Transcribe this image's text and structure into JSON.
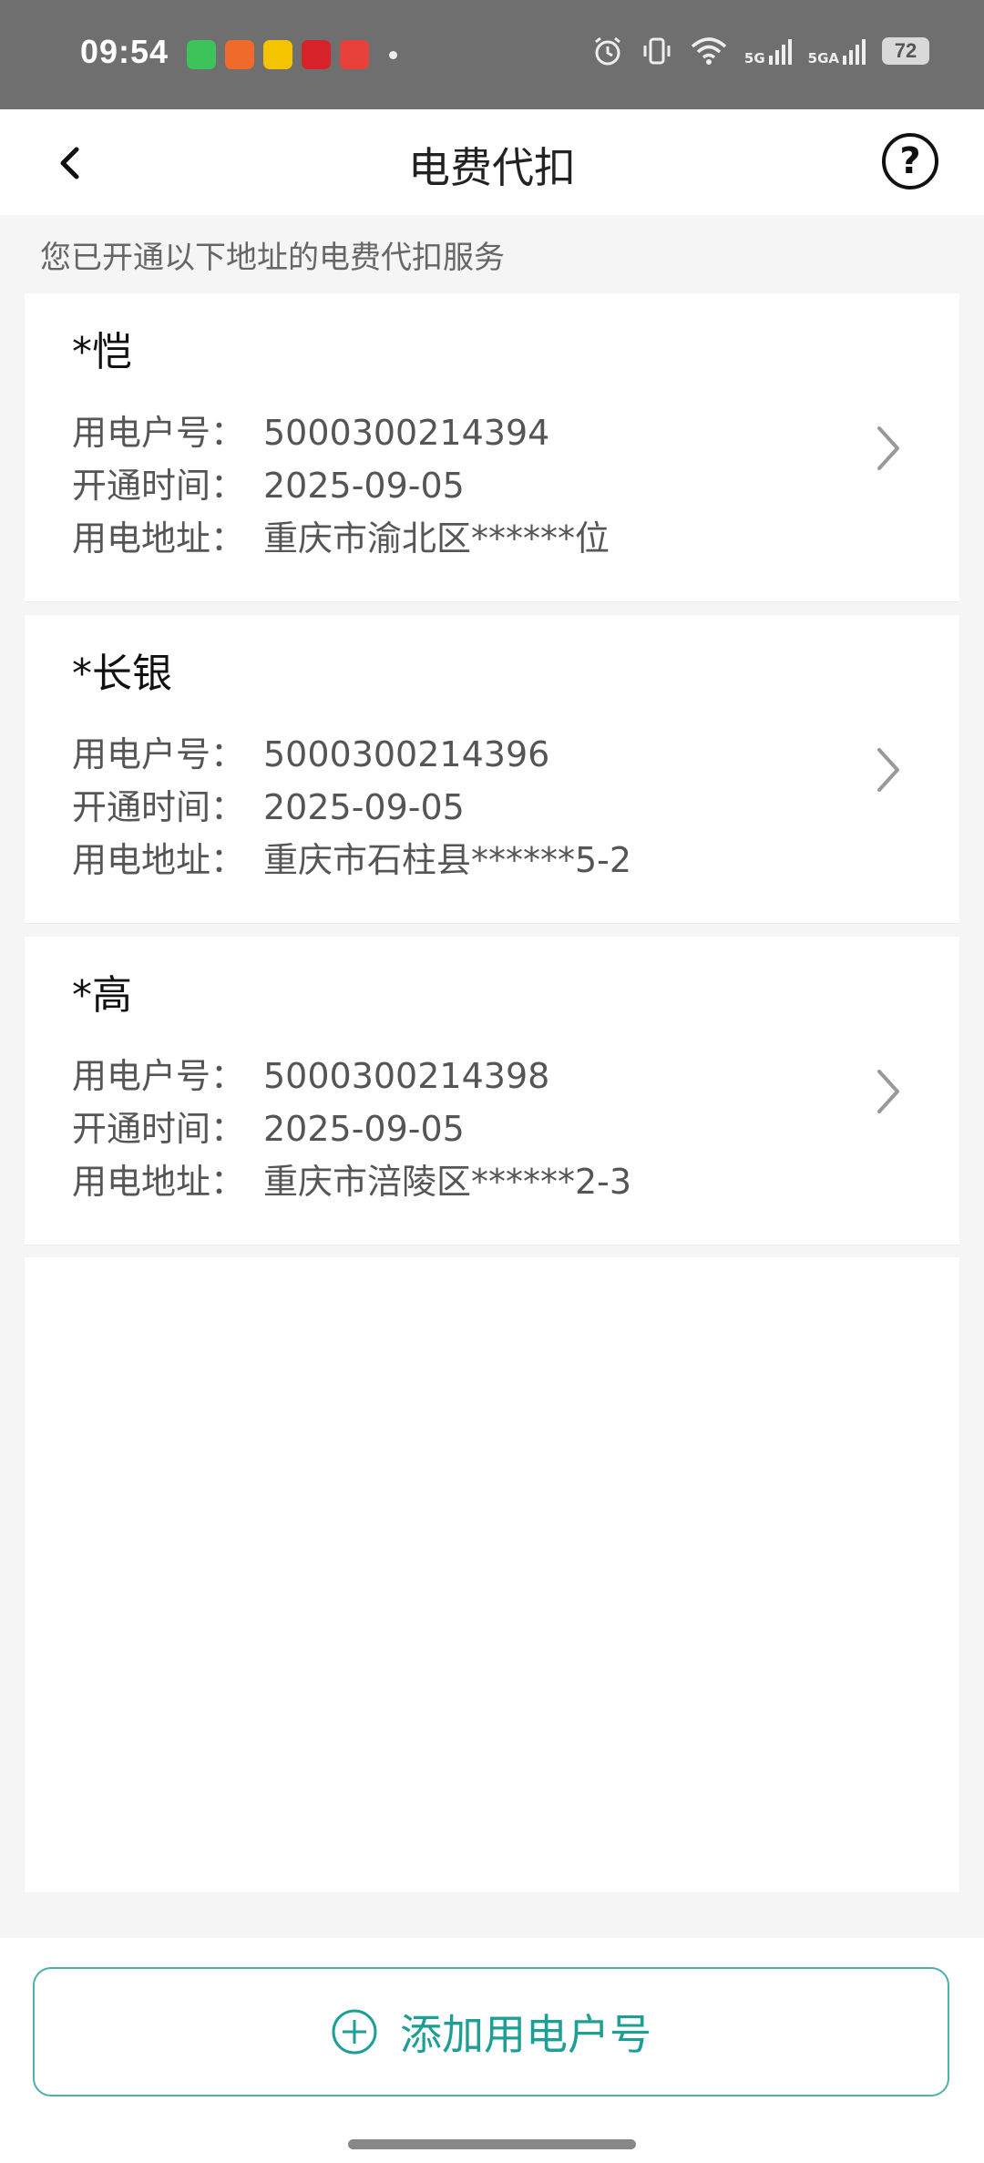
{
  "status_bar": {
    "time": "09:54",
    "battery": "72",
    "signal1": "5G",
    "signal2": "5GA",
    "app_icons": [
      "messages-app-icon",
      "taobao-app-icon",
      "qimao-app-icon",
      "unionpay-app-icon",
      "bank-app-icon"
    ]
  },
  "header": {
    "title": "电费代扣",
    "help_symbol": "?"
  },
  "subtitle": "您已开通以下地址的电费代扣服务",
  "labels": {
    "account": "用电户号：",
    "open_time": "开通时间：",
    "address": "用电地址："
  },
  "accounts": [
    {
      "name": "*恺",
      "account": "5000300214394",
      "open_time": "2025-09-05",
      "address": "重庆市渝北区******位"
    },
    {
      "name": "*长银",
      "account": "5000300214396",
      "open_time": "2025-09-05",
      "address": "重庆市石柱县******5-2"
    },
    {
      "name": "*高",
      "account": "5000300214398",
      "open_time": "2025-09-05",
      "address": "重庆市涪陵区******2-3"
    }
  ],
  "add_button": {
    "label": "添加用电户号"
  },
  "colors": {
    "accent": "#1e9f95",
    "status_bar": "#6f6f6f"
  }
}
